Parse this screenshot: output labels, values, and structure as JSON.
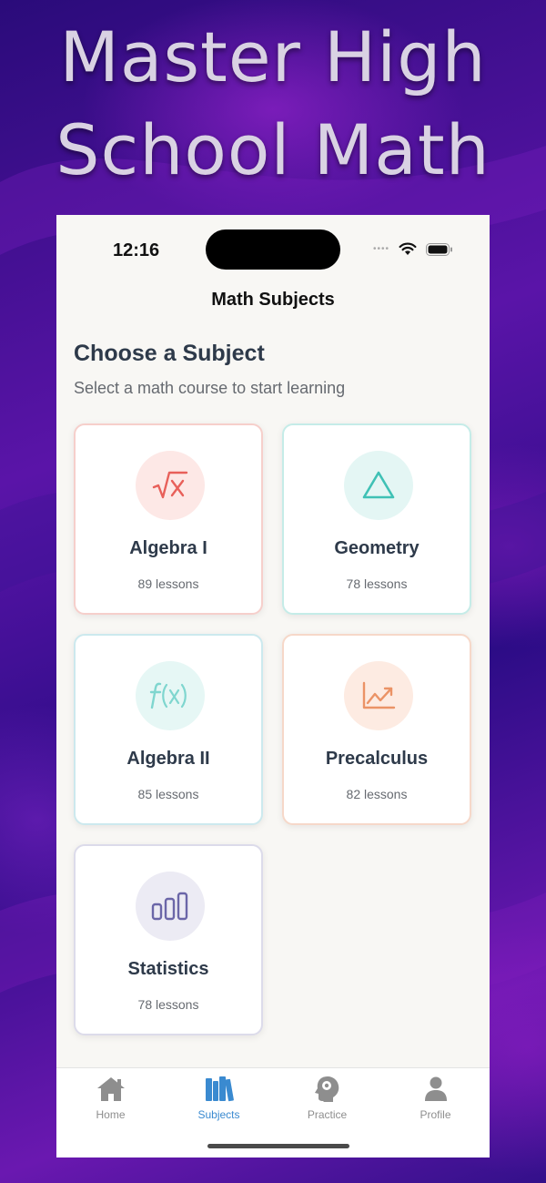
{
  "hero": {
    "line1": "Master High",
    "line2": "School Math"
  },
  "status_bar": {
    "time": "12:16"
  },
  "nav": {
    "title": "Math Subjects"
  },
  "intro": {
    "heading": "Choose a Subject",
    "subheading": "Select a math course to start learning"
  },
  "subjects": [
    {
      "title": "Algebra I",
      "lessons": "89 lessons",
      "icon": "square-root-icon",
      "accent": "#e8605a",
      "tint": "#fde8e6",
      "border": "#f6cfcb"
    },
    {
      "title": "Geometry",
      "lessons": "78 lessons",
      "icon": "triangle-icon",
      "accent": "#3fc1b5",
      "tint": "#e4f6f4",
      "border": "#c5ece8"
    },
    {
      "title": "Algebra II",
      "lessons": "85 lessons",
      "icon": "function-icon",
      "accent": "#7fd6cf",
      "tint": "#e6f7f5",
      "border": "#cce9ee"
    },
    {
      "title": "Precalculus",
      "lessons": "82 lessons",
      "icon": "line-chart-icon",
      "accent": "#eb9366",
      "tint": "#fdebe2",
      "border": "#f6d8c9"
    },
    {
      "title": "Statistics",
      "lessons": "78 lessons",
      "icon": "bar-chart-icon",
      "accent": "#6b66a8",
      "tint": "#ecebf4",
      "border": "#dcdbea"
    }
  ],
  "tabs": [
    {
      "label": "Home",
      "icon": "house-icon",
      "active": false
    },
    {
      "label": "Subjects",
      "icon": "books-icon",
      "active": true
    },
    {
      "label": "Practice",
      "icon": "brain-head-icon",
      "active": false
    },
    {
      "label": "Profile",
      "icon": "person-icon",
      "active": false
    }
  ],
  "colors": {
    "active_tab": "#3a8ad0",
    "inactive_tab": "#8e8e8e",
    "heading": "#2e3a4a"
  }
}
